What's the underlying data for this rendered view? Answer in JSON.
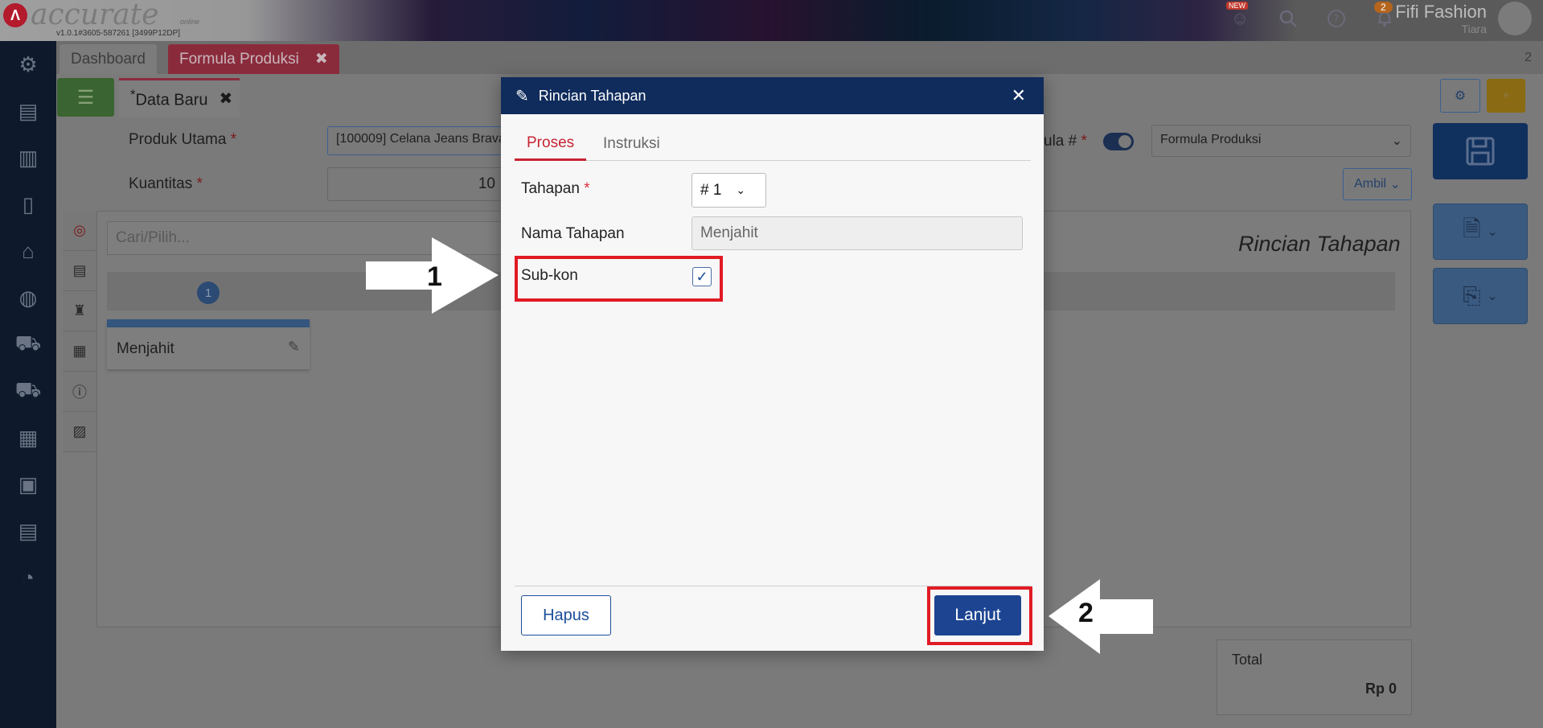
{
  "app": {
    "logo_text": "accurate",
    "logo_online": "online",
    "version": "v1.0.1#3605-587261 [3499P12DP]",
    "new_badge": "NEW",
    "notification_count": "2",
    "company_name": "Fifi Fashion",
    "user_name": "Tiara"
  },
  "tabs": {
    "dashboard": "Dashboard",
    "formula": "Formula Produksi",
    "close_glyph": "✖",
    "tab_count": "2"
  },
  "subbar": {
    "data_tab": "Data Baru",
    "data_tab_marker": "*",
    "close_glyph": "✖"
  },
  "form": {
    "produk_label": "Produk Utama",
    "produk_value": "[100009] Celana Jeans Brava",
    "kuantitas_label": "Kuantitas",
    "kuantitas_value": "10",
    "formula_label": "ula #",
    "formula_select": "Formula Produksi",
    "required_mark": "*",
    "ambil_label": "Ambil",
    "search_placeholder": "Cari/Pilih...",
    "step_number": "1",
    "card_label": "Menjahit",
    "section_title": "Rincian Tahapan",
    "total_label": "Total",
    "total_value": "Rp 0"
  },
  "modal": {
    "title": "Rincian Tahapan",
    "close_glyph": "✕",
    "tab_proses": "Proses",
    "tab_instruksi": "Instruksi",
    "tahapan_label": "Tahapan",
    "tahapan_value": "# 1",
    "nama_label": "Nama Tahapan",
    "nama_value": "Menjahit",
    "subkon_label": "Sub-kon",
    "subkon_checked": true,
    "hapus_label": "Hapus",
    "lanjut_label": "Lanjut",
    "required_mark": "*"
  },
  "annotations": {
    "callout_1": "1",
    "callout_2": "2",
    "highlight_color": "#e01b24"
  },
  "colors": {
    "accent_red": "#c82333",
    "primary_blue": "#1c4491",
    "header_navy": "#0f2c5c"
  }
}
